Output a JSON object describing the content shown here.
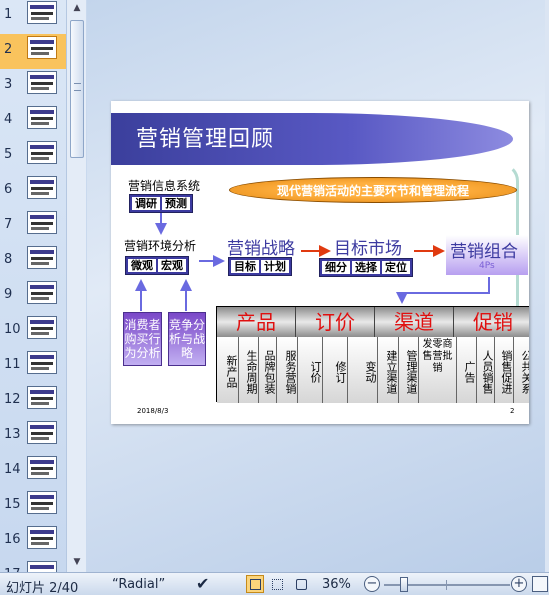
{
  "thumbnails": {
    "items": [
      {
        "num": "1"
      },
      {
        "num": "2",
        "selected": true
      },
      {
        "num": "3"
      },
      {
        "num": "4"
      },
      {
        "num": "5"
      },
      {
        "num": "6"
      },
      {
        "num": "7"
      },
      {
        "num": "8"
      },
      {
        "num": "9"
      },
      {
        "num": "10"
      },
      {
        "num": "11"
      },
      {
        "num": "12"
      },
      {
        "num": "13"
      },
      {
        "num": "14"
      },
      {
        "num": "15"
      },
      {
        "num": "16"
      },
      {
        "num": "17"
      }
    ]
  },
  "slide": {
    "title": "营销管理回顾",
    "oval_text": "现代营销活动的主要环节和管理流程",
    "info_system": {
      "label": "营销信息系统",
      "chips": [
        "调研",
        "预测"
      ]
    },
    "env_analysis": {
      "label": "营销环境分析",
      "chips": [
        "微观",
        "宏观"
      ]
    },
    "strategy": {
      "label": "营销战略",
      "chips": [
        "目标",
        "计划"
      ]
    },
    "target_market": {
      "label": "目标市场",
      "chips": [
        "细分",
        "选择",
        "定位"
      ]
    },
    "combo": {
      "label": "营销组合",
      "sub": "4Ps"
    },
    "consumer_box": "消费者购买行为分析",
    "competitor_box": "竞争分析与战略",
    "table": {
      "headers": [
        "产品",
        "订价",
        "渠道",
        "促销"
      ],
      "cells": [
        "新产品",
        "生命周期",
        "品牌包装",
        "服务营销",
        "订价",
        "修订",
        "变动",
        "建立渠道",
        "管理渠道",
        "发零商售营批销",
        "广告",
        "人员销售",
        "销售促进",
        "公共关系"
      ]
    },
    "date": "2018/8/3",
    "page_number": "2"
  },
  "status_bar": {
    "slide_info": "幻灯片 2/40",
    "theme": "“Radial”",
    "zoom": "36%"
  },
  "colors": {
    "title_band": "#3b3f9c",
    "accent_orange": "#e48914",
    "table_header_text": "#e01010",
    "selected_thumb": "#f9c35d"
  }
}
